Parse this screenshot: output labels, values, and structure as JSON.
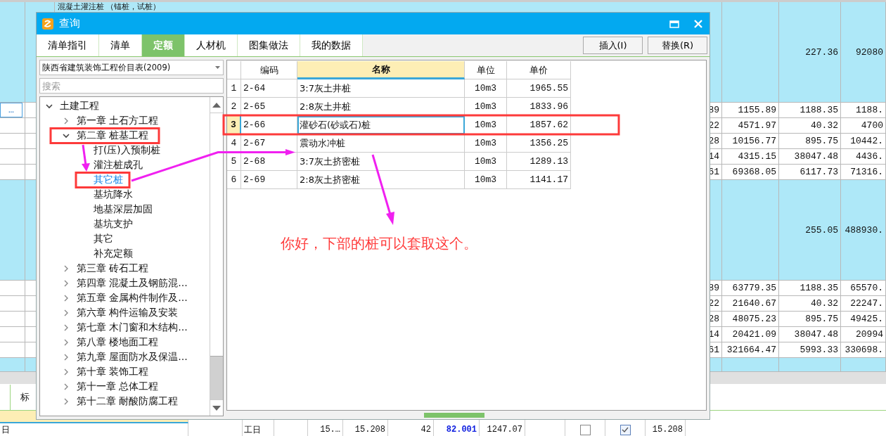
{
  "background_table": {
    "rows": [
      {
        "kind": "group",
        "title": "混凝土灌注桩 （锚桩，试桩）",
        "cells": [
          "",
          "",
          "227.36",
          "92080"
        ]
      },
      {
        "kind": "item",
        "button": "…",
        "cells": [
          "89",
          "1155.89",
          "1188.35",
          "1188."
        ]
      },
      {
        "kind": "item",
        "cells": [
          "22",
          "4571.97",
          "40.32",
          "4700"
        ]
      },
      {
        "kind": "item",
        "cells": [
          "28",
          "10156.77",
          "895.75",
          "10442."
        ]
      },
      {
        "kind": "item",
        "cells": [
          "14",
          "4315.15",
          "38047.48",
          "4436."
        ]
      },
      {
        "kind": "item",
        "cells": [
          "61",
          "69368.05",
          "6117.73",
          "71316."
        ]
      },
      {
        "kind": "group",
        "cells": [
          "",
          "",
          "255.05",
          "488930."
        ]
      },
      {
        "kind": "item",
        "cells": [
          "89",
          "63779.35",
          "1188.35",
          "65570."
        ]
      },
      {
        "kind": "item",
        "cells": [
          "22",
          "21640.67",
          "40.32",
          "22247."
        ]
      },
      {
        "kind": "item",
        "cells": [
          "28",
          "48075.23",
          "895.75",
          "49425."
        ]
      },
      {
        "kind": "item",
        "cells": [
          "14",
          "20421.09",
          "38047.48",
          "20994"
        ]
      },
      {
        "kind": "item",
        "cells": [
          "61",
          "321664.47",
          "5993.33",
          "330698."
        ]
      },
      {
        "kind": "total",
        "cells": [
          "",
          "",
          "",
          ""
        ]
      }
    ]
  },
  "bottom_panel": {
    "tab": "标",
    "row": [
      {
        "kind": "text",
        "text": "日"
      },
      {
        "kind": "empty"
      },
      {
        "kind": "text",
        "text": "工日"
      },
      {
        "kind": "empty"
      },
      {
        "kind": "number",
        "text": "15.…"
      },
      {
        "kind": "number",
        "text": "15.208"
      },
      {
        "kind": "number",
        "text": "42"
      },
      {
        "kind": "link",
        "text": "82.001"
      },
      {
        "kind": "number",
        "text": "1247.07"
      },
      {
        "kind": "empty"
      },
      {
        "kind": "checkbox",
        "checked": false
      },
      {
        "kind": "checkbox",
        "checked": true
      },
      {
        "kind": "number",
        "text": "15.208"
      }
    ]
  },
  "dialog": {
    "title": "查询",
    "tabs": [
      {
        "label": "清单指引",
        "selected": false
      },
      {
        "label": "清单",
        "selected": false
      },
      {
        "label": "定额",
        "selected": true
      },
      {
        "label": "人材机",
        "selected": false
      },
      {
        "label": "图集做法",
        "selected": false
      },
      {
        "label": "我的数据",
        "selected": false
      }
    ],
    "buttons": [
      "插入(I)",
      "替换(R)"
    ],
    "library": "陕西省建筑装饰工程价目表(2009)",
    "search": {
      "placeholder": "搜索"
    },
    "tree": [
      {
        "label": "土建工程",
        "expanded": true,
        "selected": false,
        "children": [
          {
            "label": "第一章 土石方工程",
            "expanded": false,
            "selected": false
          },
          {
            "label": "第二章 桩基工程",
            "expanded": true,
            "selected": false,
            "children": [
              {
                "label": "打(压)入预制桩",
                "selected": false
              },
              {
                "label": "灌注桩成孔",
                "selected": false
              },
              {
                "label": "其它桩",
                "selected": true
              },
              {
                "label": "基坑降水",
                "selected": false
              },
              {
                "label": "地基深层加固",
                "selected": false
              },
              {
                "label": "基坑支护",
                "selected": false
              },
              {
                "label": "其它",
                "selected": false
              },
              {
                "label": "补充定额",
                "selected": false
              }
            ]
          },
          {
            "label": "第三章 砖石工程",
            "expanded": false,
            "selected": false
          },
          {
            "label": "第四章 混凝土及钢筋混…",
            "expanded": false,
            "selected": false
          },
          {
            "label": "第五章 金属构件制作及…",
            "expanded": false,
            "selected": false
          },
          {
            "label": "第六章 构件运输及安装",
            "expanded": false,
            "selected": false
          },
          {
            "label": "第七章 木门窗和木结构…",
            "expanded": false,
            "selected": false
          },
          {
            "label": "第八章 楼地面工程",
            "expanded": false,
            "selected": false
          },
          {
            "label": "第九章 屋面防水及保温…",
            "expanded": false,
            "selected": false
          },
          {
            "label": "第十章 装饰工程",
            "expanded": false,
            "selected": false
          },
          {
            "label": "第十一章 总体工程",
            "expanded": false,
            "selected": false
          },
          {
            "label": "第十二章 耐酸防腐工程",
            "expanded": false,
            "selected": false
          }
        ]
      }
    ],
    "grid": {
      "columns": [
        "编码",
        "名称",
        "单位",
        "单价"
      ],
      "rows": [
        {
          "num": "1",
          "code": "2-64",
          "name": "3:7灰土井桩",
          "unit": "10m3",
          "price": "1965.55",
          "selected": false
        },
        {
          "num": "2",
          "code": "2-65",
          "name": "2:8灰土井桩",
          "unit": "10m3",
          "price": "1833.96",
          "selected": false
        },
        {
          "num": "3",
          "code": "2-66",
          "name": "灌砂石(砂或石)桩",
          "unit": "10m3",
          "price": "1857.62",
          "selected": true
        },
        {
          "num": "4",
          "code": "2-67",
          "name": "震动水冲桩",
          "unit": "10m3",
          "price": "1356.25",
          "selected": false
        },
        {
          "num": "5",
          "code": "2-68",
          "name": "3:7灰土挤密桩",
          "unit": "10m3",
          "price": "1289.13",
          "selected": false
        },
        {
          "num": "6",
          "code": "2-69",
          "name": "2:8灰土挤密桩",
          "unit": "10m3",
          "price": "1141.17",
          "selected": false
        }
      ]
    }
  },
  "annotation": {
    "text": "你好，下部的桩可以套取这个。"
  }
}
